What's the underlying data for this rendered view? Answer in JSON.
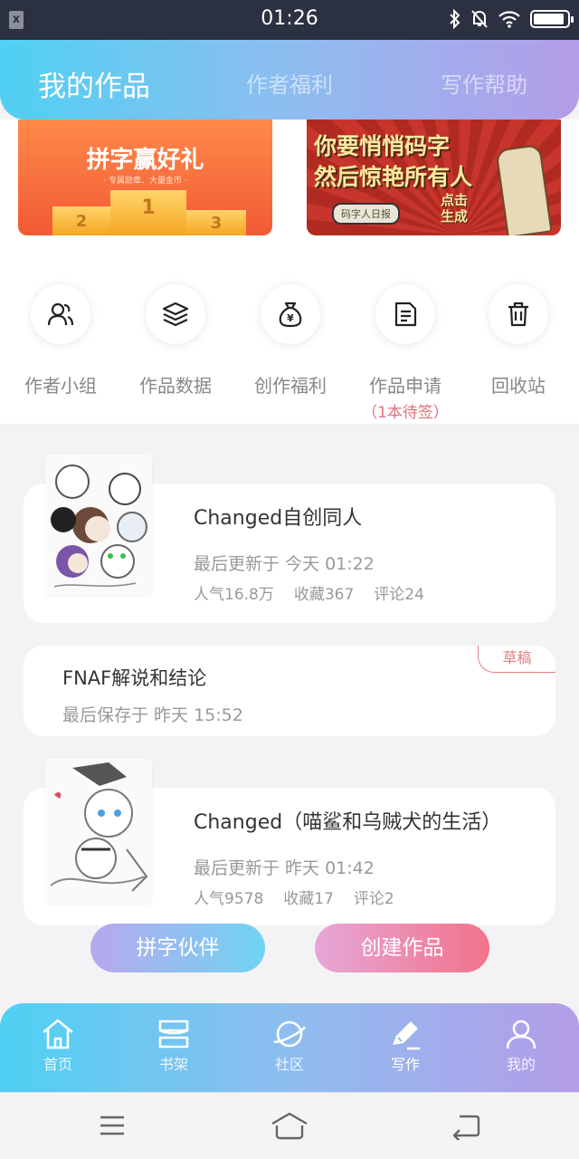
{
  "status_bar": {
    "time": "01:26",
    "sim_glyph": "x",
    "icons": [
      "bluetooth-icon",
      "mute-icon",
      "wifi-icon",
      "battery-icon"
    ]
  },
  "header": {
    "tabs": [
      {
        "label": "我的作品",
        "active": true
      },
      {
        "label": "作者福利",
        "active": false
      },
      {
        "label": "写作帮助",
        "active": false
      }
    ]
  },
  "banners": {
    "left": {
      "title": "拼字赢好礼",
      "subtitle": "· 专属勋章、大量金币 ·",
      "ranks": [
        "2",
        "1",
        "3"
      ]
    },
    "right": {
      "line1": "你要悄悄码字",
      "line2": "然后惊艳所有人",
      "tag": "码字人日报",
      "cta": "点击\n生成"
    }
  },
  "actions": [
    {
      "label": "作者小组",
      "icon": "users-icon"
    },
    {
      "label": "作品数据",
      "icon": "layers-icon"
    },
    {
      "label": "创作福利",
      "icon": "money-bag-icon"
    },
    {
      "label": "作品申请",
      "icon": "document-icon",
      "sub": "（1本待签）"
    },
    {
      "label": "回收站",
      "icon": "trash-icon"
    }
  ],
  "works": [
    {
      "title": "Changed自创同人",
      "updated": "最后更新于 今天 01:22",
      "stats": [
        "人气16.8万",
        "收藏367",
        "评论24"
      ]
    },
    {
      "title": "Changed（喵鲨和乌贼犬的生活）",
      "updated": "最后更新于 昨天 01:42",
      "stats": [
        "人气9578",
        "收藏17",
        "评论2"
      ]
    }
  ],
  "draft": {
    "title": "FNAF解说和结论",
    "saved": "最后保存于 昨天 15:52",
    "tag": "草稿"
  },
  "buttons": {
    "partner": "拼字伙伴",
    "create": "创建作品"
  },
  "bottom_nav": [
    {
      "label": "首页",
      "icon": "home-icon"
    },
    {
      "label": "书架",
      "icon": "bookshelf-icon"
    },
    {
      "label": "社区",
      "icon": "planet-icon"
    },
    {
      "label": "写作",
      "icon": "pen-icon",
      "active": true
    },
    {
      "label": "我的",
      "icon": "user-icon"
    }
  ],
  "system_bar": [
    "menu-icon",
    "home-icon",
    "back-icon"
  ]
}
